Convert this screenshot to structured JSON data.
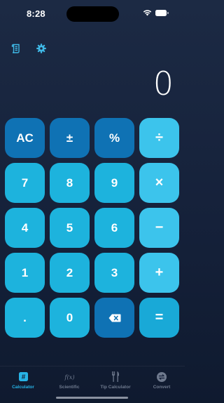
{
  "status_bar": {
    "time": "8:28"
  },
  "display": {
    "value": "0"
  },
  "keypad": {
    "rows": [
      [
        "AC",
        "±",
        "%",
        "÷"
      ],
      [
        "7",
        "8",
        "9",
        "×"
      ],
      [
        "4",
        "5",
        "6",
        "−"
      ],
      [
        "1",
        "2",
        "3",
        "+"
      ],
      [
        ".",
        "0",
        "",
        "="
      ]
    ]
  },
  "tabs": [
    {
      "label": "Calculator",
      "icon": "calculator-icon",
      "active": true
    },
    {
      "label": "Scientific",
      "icon": "function-icon",
      "active": false
    },
    {
      "label": "Tip Calculator",
      "icon": "utensils-icon",
      "active": false
    },
    {
      "label": "Convert",
      "icon": "convert-icon",
      "active": false
    }
  ],
  "colors": {
    "accent": "#27b3e6",
    "key_dark": "#0f72b4",
    "key_number": "#1db3dd",
    "key_operator": "#3cc4ec",
    "background": "#1c2a44"
  }
}
